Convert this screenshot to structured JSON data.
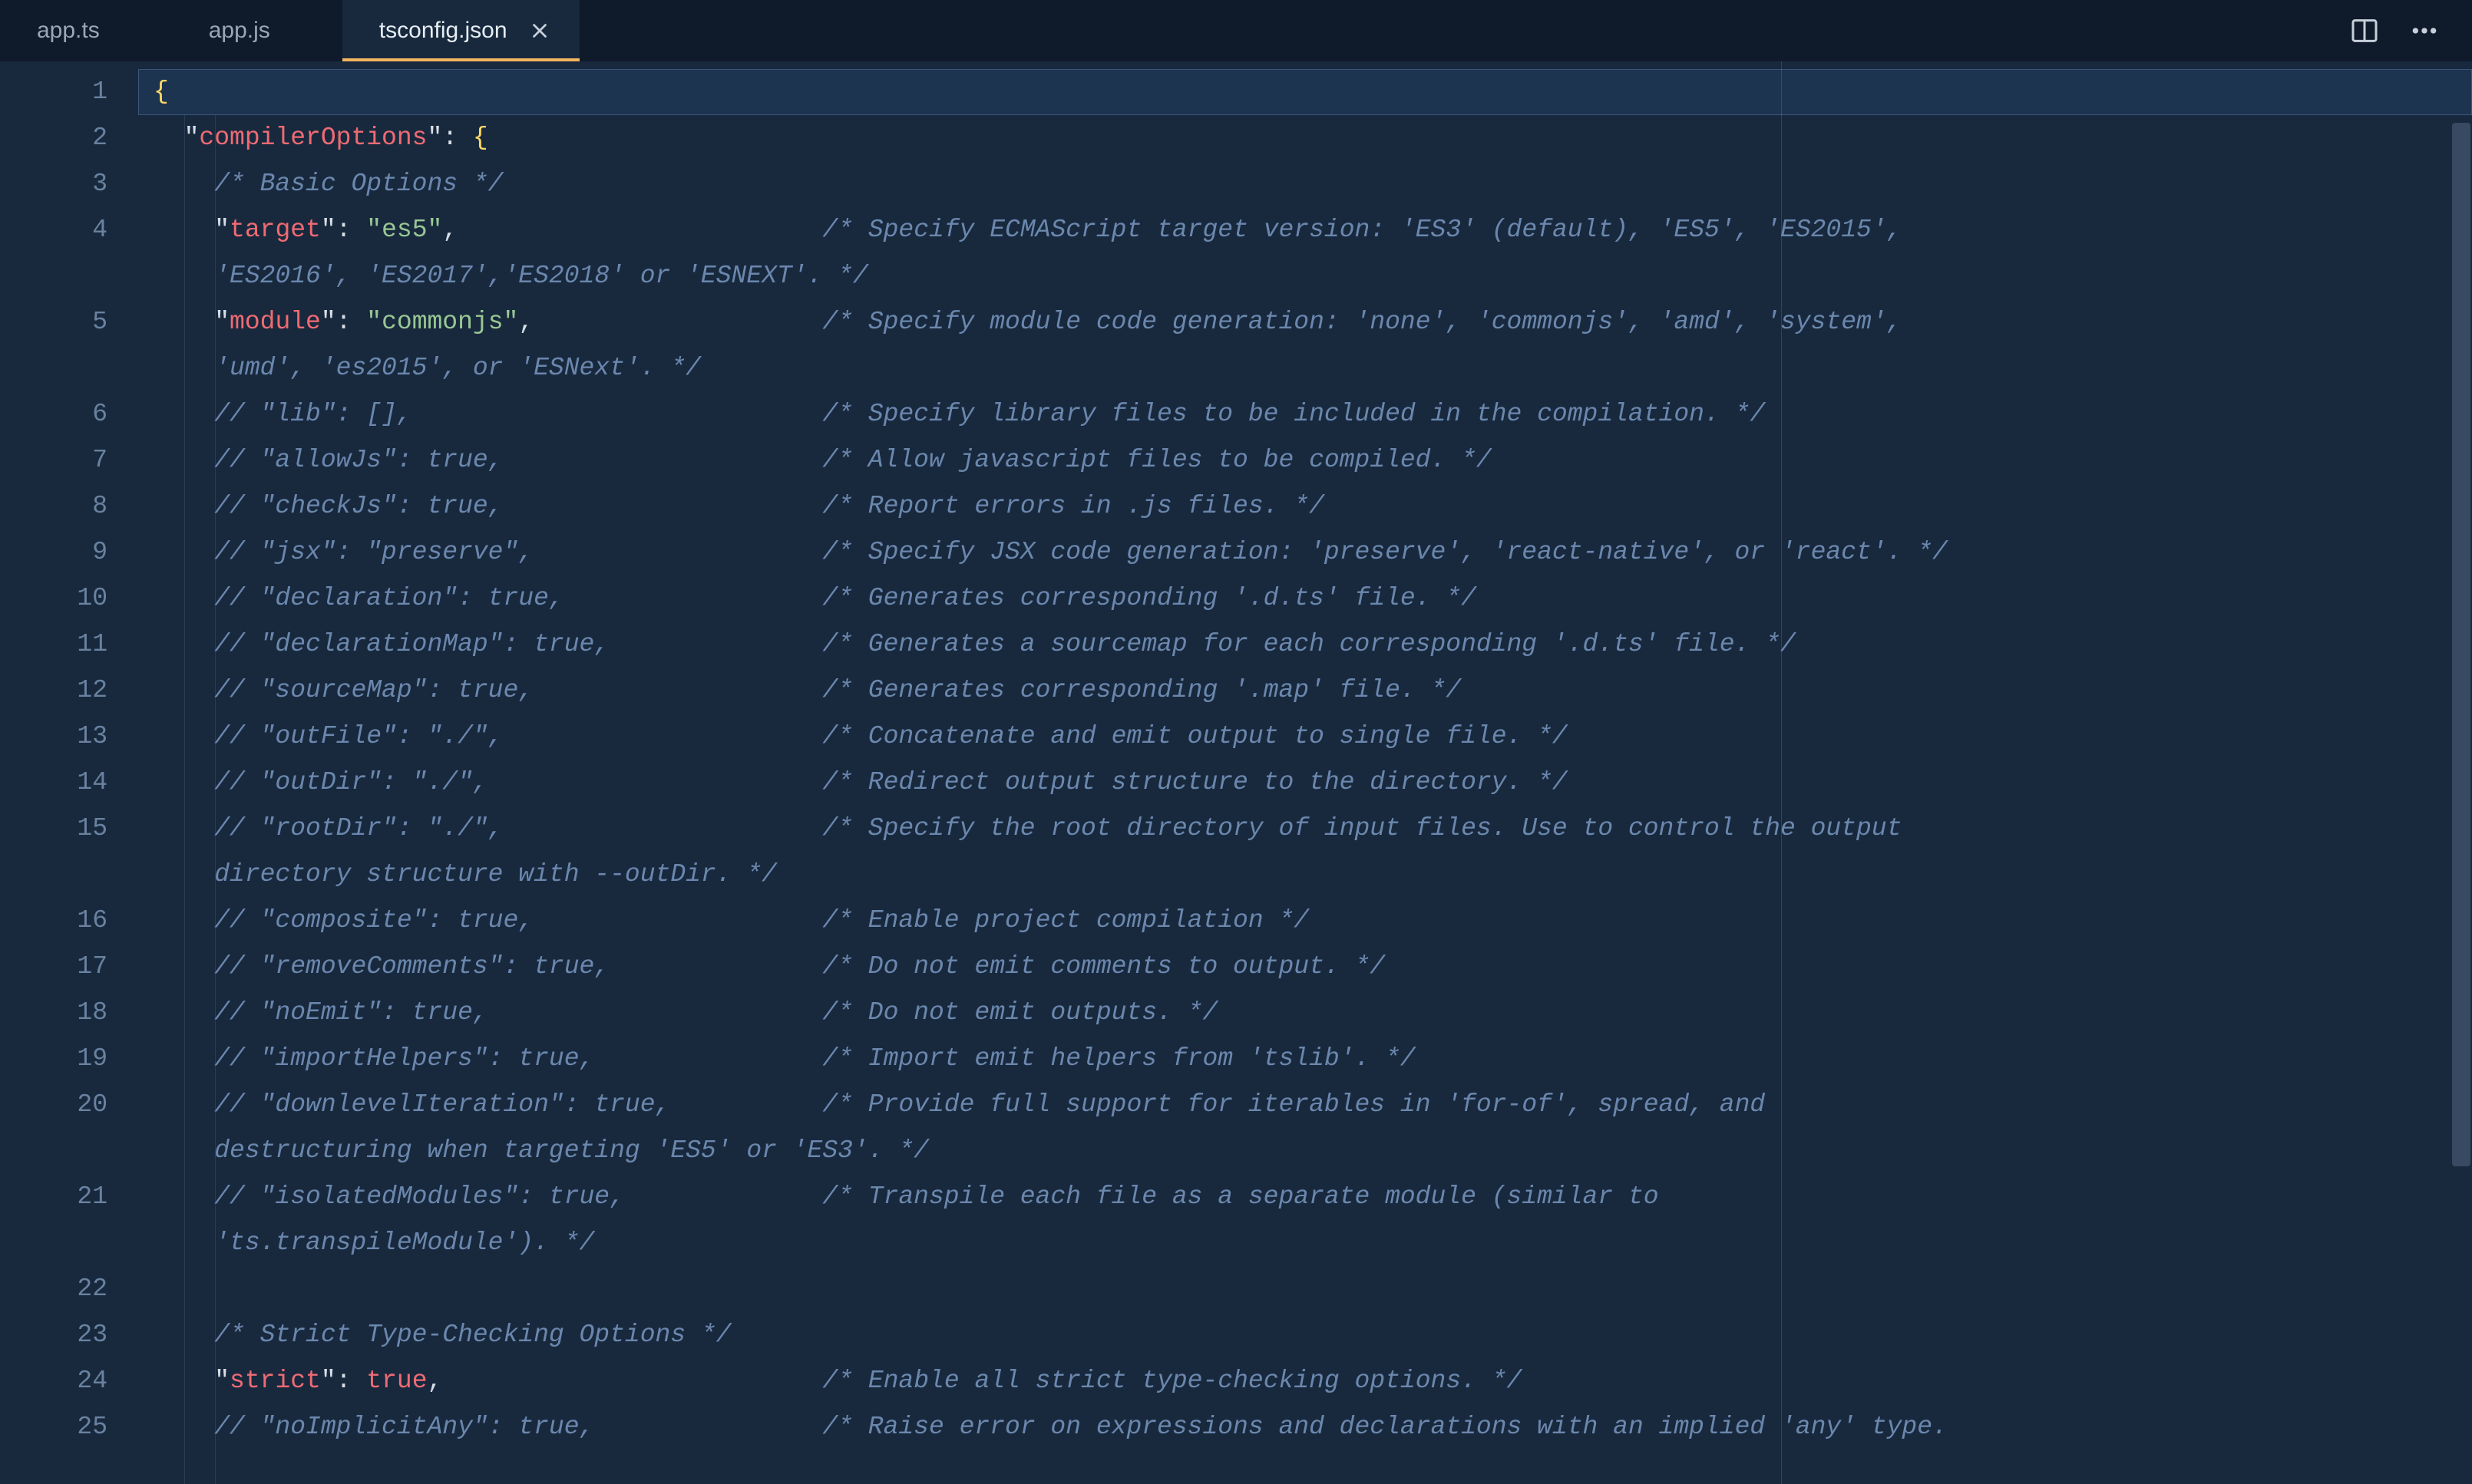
{
  "tabs": [
    {
      "label": "app.ts",
      "active": false,
      "closable": false
    },
    {
      "label": "app.js",
      "active": false,
      "closable": false
    },
    {
      "label": "tsconfig.json",
      "active": true,
      "closable": true
    }
  ],
  "icons": {
    "close": "close-icon",
    "splitEditor": "split-editor-icon",
    "more": "more-icon"
  },
  "code": {
    "L1": {
      "indent": 0,
      "tokens": [
        {
          "c": "tk-brace",
          "t": "{"
        }
      ]
    },
    "L2": {
      "indent": 1,
      "tokens": [
        {
          "c": "tk-punc",
          "t": "\""
        },
        {
          "c": "tk-key",
          "t": "compilerOptions"
        },
        {
          "c": "tk-punc",
          "t": "\": "
        },
        {
          "c": "tk-brace",
          "t": "{"
        }
      ]
    },
    "L3": {
      "indent": 2,
      "tokens": [
        {
          "c": "tk-blockcm",
          "t": "/* Basic Options */"
        }
      ]
    },
    "L4": {
      "indent": 2,
      "col2": true,
      "tokens": [
        {
          "c": "tk-punc",
          "t": "\""
        },
        {
          "c": "tk-key",
          "t": "target"
        },
        {
          "c": "tk-punc",
          "t": "\": "
        },
        {
          "c": "tk-str",
          "t": "\"es5\""
        },
        {
          "c": "tk-punc",
          "t": ","
        }
      ],
      "comment": "/* Specify ECMAScript target version: 'ES3' (default), 'ES5', 'ES2015', "
    },
    "L4b": {
      "indent": 2,
      "tokens": [
        {
          "c": "tk-blockcm",
          "t": "'ES2016', 'ES2017','ES2018' or 'ESNEXT'. */"
        }
      ]
    },
    "L5": {
      "indent": 2,
      "col2": true,
      "tokens": [
        {
          "c": "tk-punc",
          "t": "\""
        },
        {
          "c": "tk-key",
          "t": "module"
        },
        {
          "c": "tk-punc",
          "t": "\": "
        },
        {
          "c": "tk-str",
          "t": "\"commonjs\""
        },
        {
          "c": "tk-punc",
          "t": ","
        }
      ],
      "comment": "/* Specify module code generation: 'none', 'commonjs', 'amd', 'system', "
    },
    "L5b": {
      "indent": 2,
      "tokens": [
        {
          "c": "tk-blockcm",
          "t": "'umd', 'es2015', or 'ESNext'. */"
        }
      ]
    },
    "L6": {
      "indent": 2,
      "col2": true,
      "tokens": [
        {
          "c": "tk-slashcm",
          "t": "// \"lib\": [],"
        }
      ],
      "comment": "/* Specify library files to be included in the compilation. */"
    },
    "L7": {
      "indent": 2,
      "col2": true,
      "tokens": [
        {
          "c": "tk-slashcm",
          "t": "// \"allowJs\": true,"
        }
      ],
      "comment": "/* Allow javascript files to be compiled. */"
    },
    "L8": {
      "indent": 2,
      "col2": true,
      "tokens": [
        {
          "c": "tk-slashcm",
          "t": "// \"checkJs\": true,"
        }
      ],
      "comment": "/* Report errors in .js files. */"
    },
    "L9": {
      "indent": 2,
      "col2": true,
      "tokens": [
        {
          "c": "tk-slashcm",
          "t": "// \"jsx\": \"preserve\","
        }
      ],
      "comment": "/* Specify JSX code generation: 'preserve', 'react-native', or 'react'. */"
    },
    "L10": {
      "indent": 2,
      "col2": true,
      "tokens": [
        {
          "c": "tk-slashcm",
          "t": "// \"declaration\": true,"
        }
      ],
      "comment": "/* Generates corresponding '.d.ts' file. */"
    },
    "L11": {
      "indent": 2,
      "col2": true,
      "tokens": [
        {
          "c": "tk-slashcm",
          "t": "// \"declarationMap\": true,"
        }
      ],
      "comment": "/* Generates a sourcemap for each corresponding '.d.ts' file. */"
    },
    "L12": {
      "indent": 2,
      "col2": true,
      "tokens": [
        {
          "c": "tk-slashcm",
          "t": "// \"sourceMap\": true,"
        }
      ],
      "comment": "/* Generates corresponding '.map' file. */"
    },
    "L13": {
      "indent": 2,
      "col2": true,
      "tokens": [
        {
          "c": "tk-slashcm",
          "t": "// \"outFile\": \"./\","
        }
      ],
      "comment": "/* Concatenate and emit output to single file. */"
    },
    "L14": {
      "indent": 2,
      "col2": true,
      "tokens": [
        {
          "c": "tk-slashcm",
          "t": "// \"outDir\": \"./\","
        }
      ],
      "comment": "/* Redirect output structure to the directory. */"
    },
    "L15": {
      "indent": 2,
      "col2": true,
      "tokens": [
        {
          "c": "tk-slashcm",
          "t": "// \"rootDir\": \"./\","
        }
      ],
      "comment": "/* Specify the root directory of input files. Use to control the output "
    },
    "L15b": {
      "indent": 2,
      "tokens": [
        {
          "c": "tk-blockcm",
          "t": "directory structure with --outDir. */"
        }
      ]
    },
    "L16": {
      "indent": 2,
      "col2": true,
      "tokens": [
        {
          "c": "tk-slashcm",
          "t": "// \"composite\": true,"
        }
      ],
      "comment": "/* Enable project compilation */"
    },
    "L17": {
      "indent": 2,
      "col2": true,
      "tokens": [
        {
          "c": "tk-slashcm",
          "t": "// \"removeComments\": true,"
        }
      ],
      "comment": "/* Do not emit comments to output. */"
    },
    "L18": {
      "indent": 2,
      "col2": true,
      "tokens": [
        {
          "c": "tk-slashcm",
          "t": "// \"noEmit\": true,"
        }
      ],
      "comment": "/* Do not emit outputs. */"
    },
    "L19": {
      "indent": 2,
      "col2": true,
      "tokens": [
        {
          "c": "tk-slashcm",
          "t": "// \"importHelpers\": true,"
        }
      ],
      "comment": "/* Import emit helpers from 'tslib'. */"
    },
    "L20": {
      "indent": 2,
      "col2": true,
      "tokens": [
        {
          "c": "tk-slashcm",
          "t": "// \"downlevelIteration\": true,"
        }
      ],
      "comment": "/* Provide full support for iterables in 'for-of', spread, and "
    },
    "L20b": {
      "indent": 2,
      "tokens": [
        {
          "c": "tk-blockcm",
          "t": "destructuring when targeting 'ES5' or 'ES3'. */"
        }
      ]
    },
    "L21": {
      "indent": 2,
      "col2": true,
      "tokens": [
        {
          "c": "tk-slashcm",
          "t": "// \"isolatedModules\": true,"
        }
      ],
      "comment": "/* Transpile each file as a separate module (similar to "
    },
    "L21b": {
      "indent": 2,
      "tokens": [
        {
          "c": "tk-blockcm",
          "t": "'ts.transpileModule'). */"
        }
      ]
    },
    "L22": {
      "indent": 0,
      "tokens": []
    },
    "L23": {
      "indent": 2,
      "tokens": [
        {
          "c": "tk-blockcm",
          "t": "/* Strict Type-Checking Options */"
        }
      ]
    },
    "L24": {
      "indent": 2,
      "col2": true,
      "tokens": [
        {
          "c": "tk-punc",
          "t": "\""
        },
        {
          "c": "tk-key",
          "t": "strict"
        },
        {
          "c": "tk-punc",
          "t": "\": "
        },
        {
          "c": "tk-bool",
          "t": "true"
        },
        {
          "c": "tk-punc",
          "t": ","
        }
      ],
      "comment": "/* Enable all strict type-checking options. */"
    },
    "L25": {
      "indent": 2,
      "col2": true,
      "tokens": [
        {
          "c": "tk-slashcm",
          "t": "// \"noImplicitAny\": true,"
        }
      ],
      "comment": "/* Raise error on expressions and declarations with an implied 'any' type. "
    }
  },
  "lineOrder": [
    "L1",
    "L2",
    "L3",
    "L4",
    "L4b",
    "L5",
    "L5b",
    "L6",
    "L7",
    "L8",
    "L9",
    "L10",
    "L11",
    "L12",
    "L13",
    "L14",
    "L15",
    "L15b",
    "L16",
    "L17",
    "L18",
    "L19",
    "L20",
    "L20b",
    "L21",
    "L21b",
    "L22",
    "L23",
    "L24",
    "L25"
  ],
  "gutterLabels": [
    "1",
    "2",
    "3",
    "4",
    "",
    "5",
    "",
    "6",
    "7",
    "8",
    "9",
    "10",
    "11",
    "12",
    "13",
    "14",
    "15",
    "",
    "16",
    "17",
    "18",
    "19",
    "20",
    "",
    "21",
    "",
    "22",
    "23",
    "24",
    "25"
  ],
  "layout": {
    "indentUnit": "  ",
    "commentColumnChars": 44,
    "highlightLine": 0
  }
}
